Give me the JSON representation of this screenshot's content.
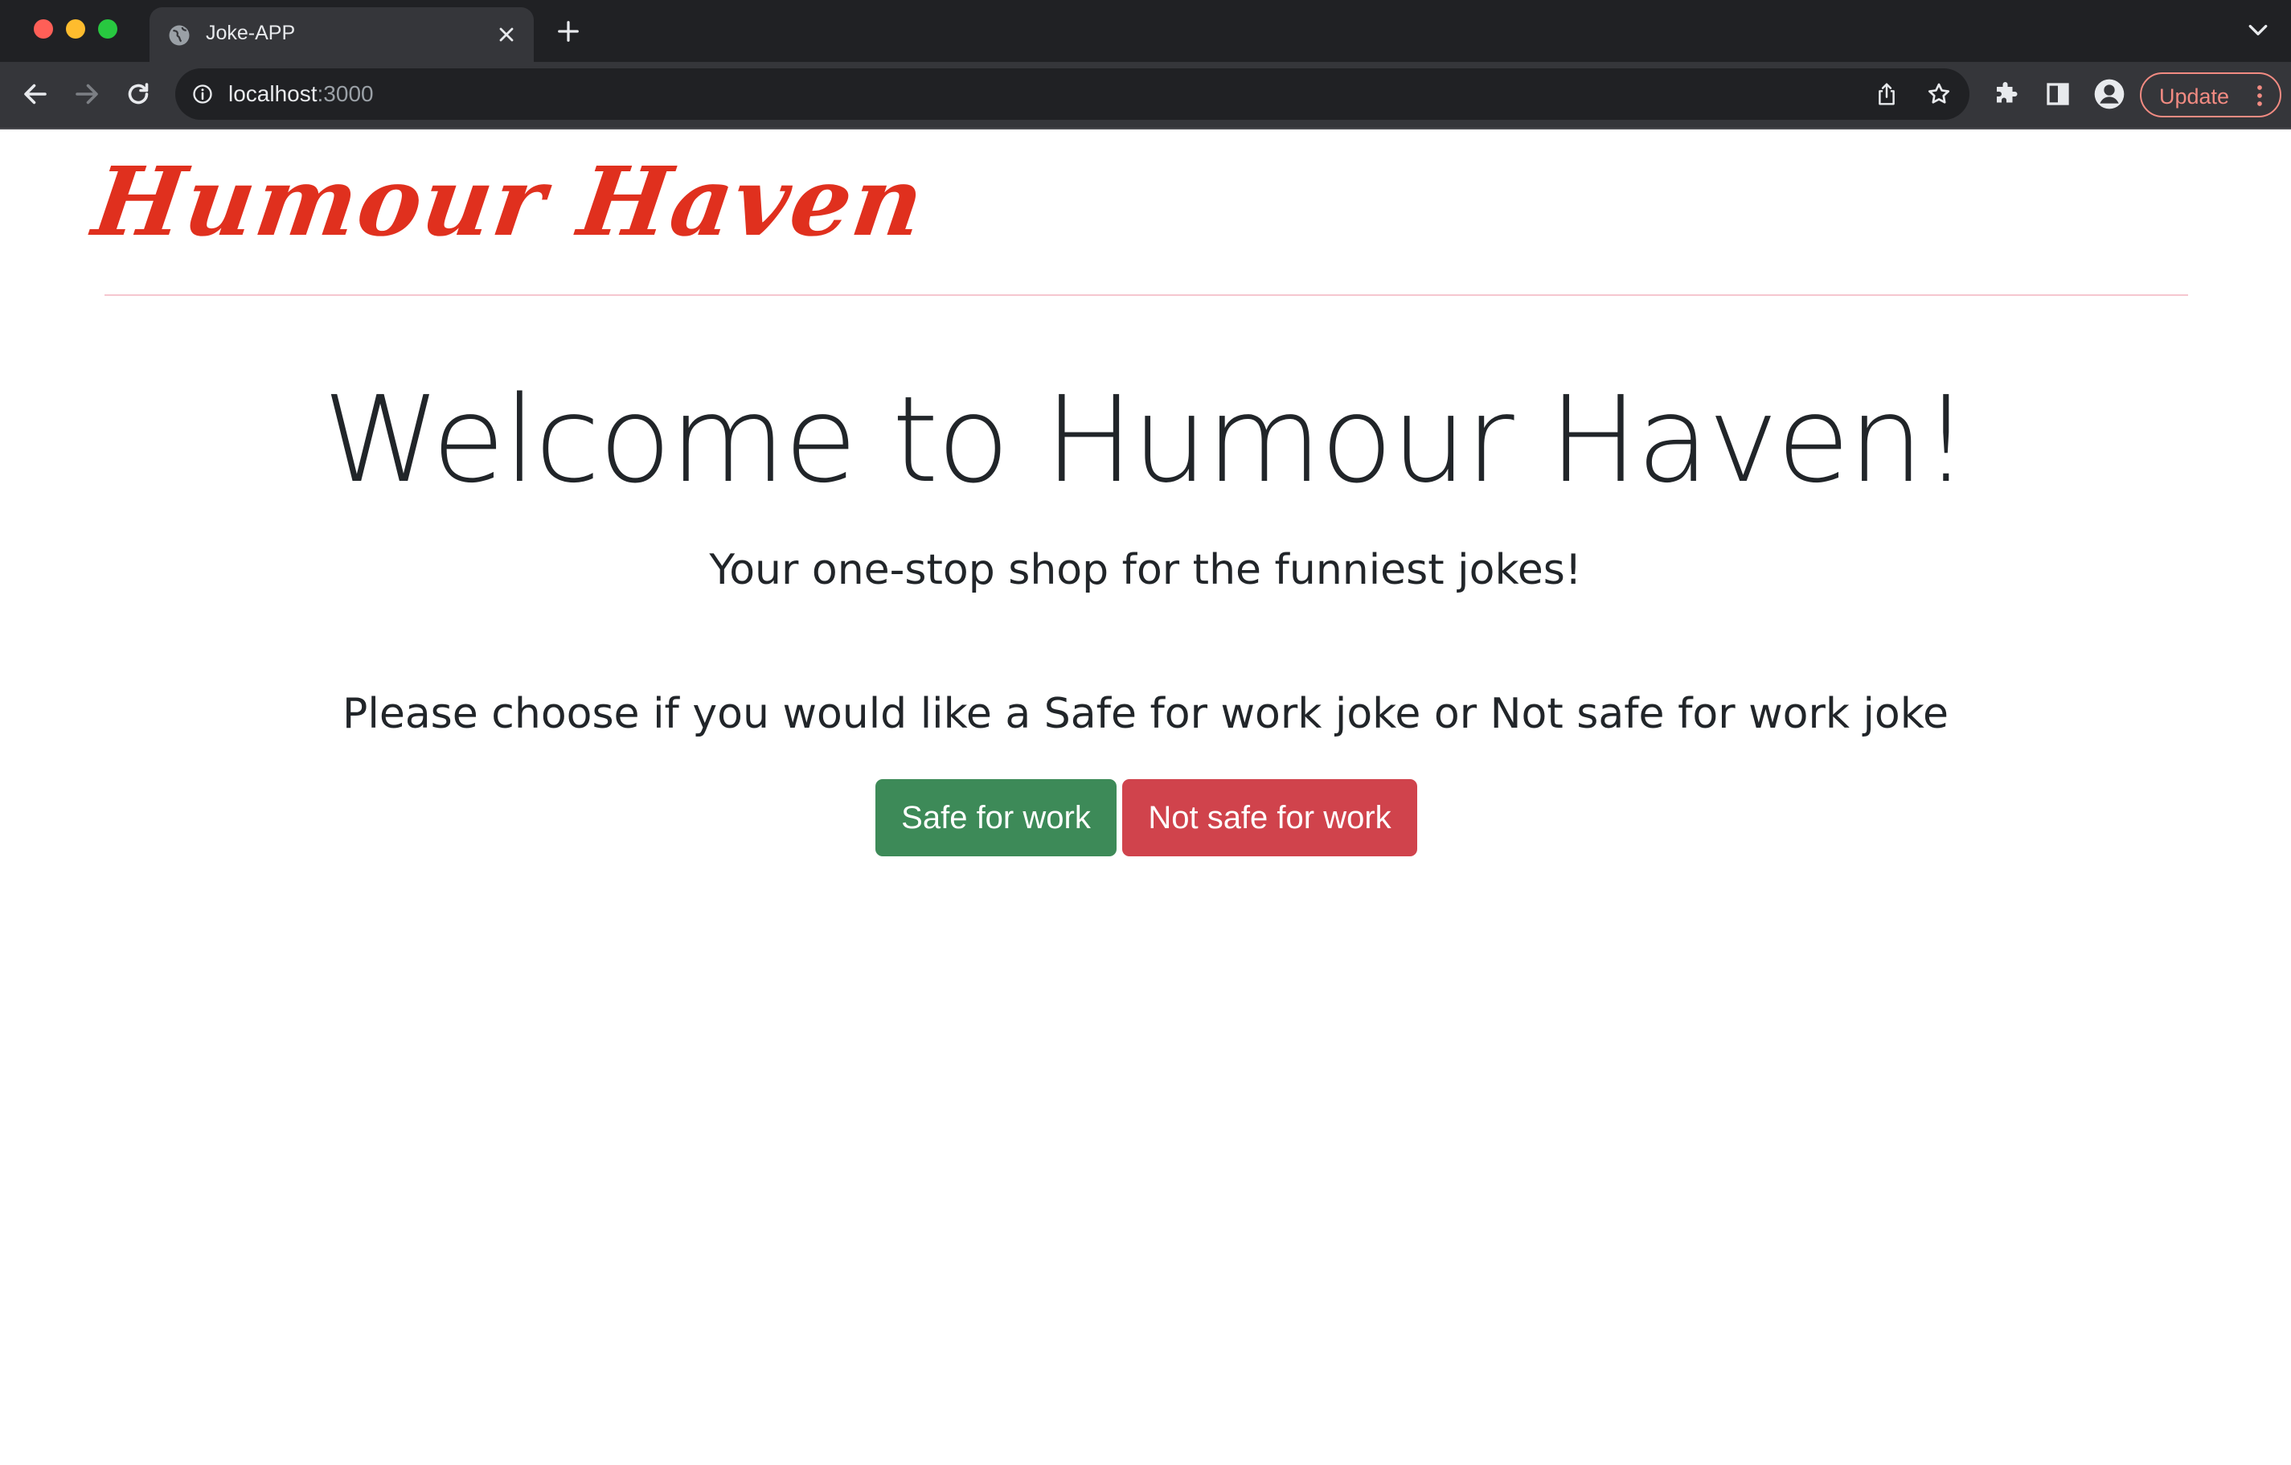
{
  "browser": {
    "tab_title": "Joke-APP",
    "url_host": "localhost",
    "url_port": ":3000",
    "update_label": "Update"
  },
  "header": {
    "brand": "Humour Haven"
  },
  "main": {
    "title": "Welcome to Humour Haven!",
    "subtitle": "Your one-stop shop for the funniest jokes!",
    "prompt": "Please choose if you would like a Safe for work joke or Not safe for work joke",
    "buttons": {
      "sfw_label": "Safe for work",
      "nsfw_label": "Not safe for work"
    }
  },
  "colors": {
    "brand": "#e0301e",
    "sfw_button": "#3d8a58",
    "nsfw_button": "#d0434c",
    "divider": "#f6c7cf",
    "text": "#212529"
  },
  "icons": [
    "globe-icon",
    "close-icon",
    "plus-icon",
    "chevron-down-icon",
    "back-arrow-icon",
    "forward-arrow-icon",
    "reload-icon",
    "info-icon",
    "share-icon",
    "star-icon",
    "puzzle-icon",
    "side-panel-icon",
    "profile-icon",
    "kebab-menu-icon"
  ]
}
